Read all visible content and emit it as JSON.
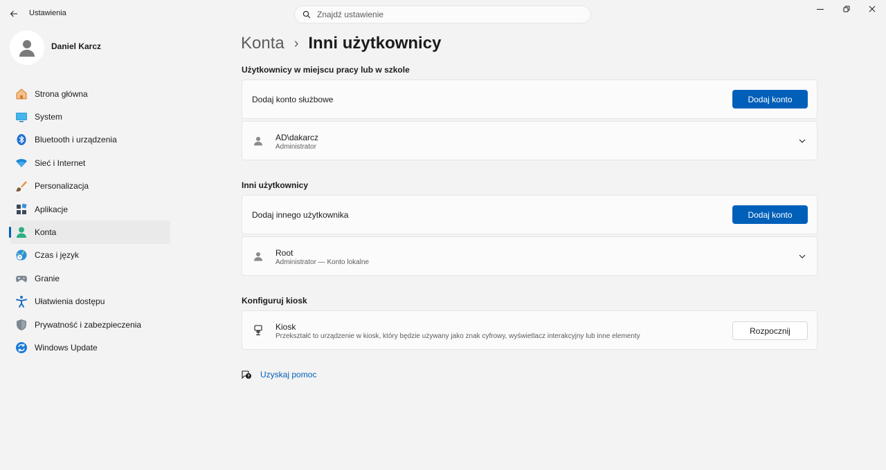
{
  "app": {
    "title": "Ustawienia"
  },
  "search": {
    "placeholder": "Znajdź ustawienie"
  },
  "profile": {
    "name": "Daniel Karcz"
  },
  "sidebar": {
    "items": [
      {
        "label": "Strona główna",
        "icon": "home-icon"
      },
      {
        "label": "System",
        "icon": "system-icon"
      },
      {
        "label": "Bluetooth i urządzenia",
        "icon": "bluetooth-icon"
      },
      {
        "label": "Sieć i Internet",
        "icon": "wifi-icon"
      },
      {
        "label": "Personalizacja",
        "icon": "brush-icon"
      },
      {
        "label": "Aplikacje",
        "icon": "apps-icon"
      },
      {
        "label": "Konta",
        "icon": "accounts-icon",
        "active": true
      },
      {
        "label": "Czas i język",
        "icon": "globe-clock-icon"
      },
      {
        "label": "Granie",
        "icon": "gamepad-icon"
      },
      {
        "label": "Ułatwienia dostępu",
        "icon": "accessibility-icon"
      },
      {
        "label": "Prywatność i zabezpieczenia",
        "icon": "shield-icon"
      },
      {
        "label": "Windows Update",
        "icon": "update-icon"
      }
    ]
  },
  "breadcrumb": {
    "parent": "Konta",
    "separator": "›",
    "current": "Inni użytkownicy"
  },
  "work": {
    "heading": "Użytkownicy w miejscu pracy lub w szkole",
    "add_label": "Dodaj konto służbowe",
    "add_button": "Dodaj konto",
    "user": {
      "name": "AD\\dakarcz",
      "role": "Administrator"
    }
  },
  "others": {
    "heading": "Inni użytkownicy",
    "add_label": "Dodaj innego użytkownika",
    "add_button": "Dodaj konto",
    "user": {
      "name": "Root",
      "role": "Administrator — Konto lokalne"
    }
  },
  "kiosk": {
    "heading": "Konfiguruj kiosk",
    "title": "Kiosk",
    "description": "Przekształć to urządzenie w kiosk, który będzie używany jako znak cyfrowy, wyświetlacz interakcyjny lub inne elementy",
    "button": "Rozpocznij"
  },
  "help": {
    "label": "Uzyskaj pomoc"
  },
  "colors": {
    "accent": "#005fb8",
    "background": "#f3f3f3",
    "card": "#fbfbfb"
  }
}
